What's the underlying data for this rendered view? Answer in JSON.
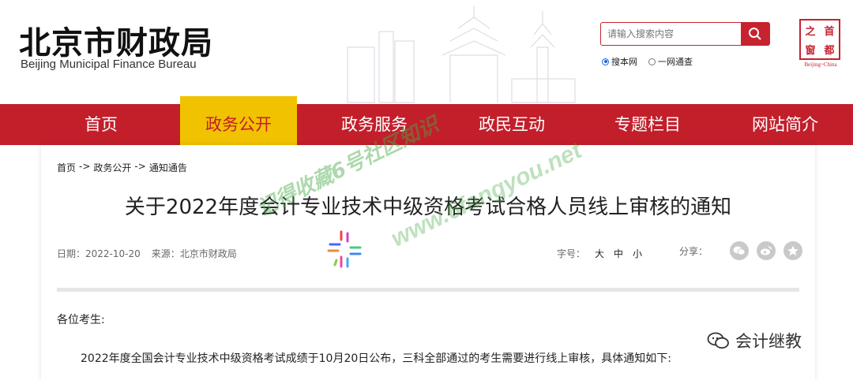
{
  "header": {
    "title_cn": "北京市财政局",
    "title_en": "Beijing Municipal Finance Bureau",
    "search": {
      "placeholder": "请输入搜索内容"
    },
    "scope_options": [
      {
        "label": "搜本网",
        "selected": true
      },
      {
        "label": "一网通查",
        "selected": false
      }
    ],
    "seal": {
      "chars": [
        "之",
        "首",
        "窗",
        "都"
      ],
      "caption": "Beijing~China"
    }
  },
  "nav": {
    "items": [
      {
        "label": "首页",
        "active": false
      },
      {
        "label": "政务公开",
        "active": true
      },
      {
        "label": "政务服务",
        "active": false
      },
      {
        "label": "政民互动",
        "active": false
      },
      {
        "label": "专题栏目",
        "active": false
      },
      {
        "label": "网站简介",
        "active": false
      }
    ]
  },
  "breadcrumb": {
    "items": [
      "首页",
      "政务公开",
      "通知通告"
    ],
    "separator": "->"
  },
  "article": {
    "title": "关于2022年度会计专业技术中级资格考试合格人员线上审核的通知",
    "date_label": "日期：",
    "date": "2022-10-20",
    "source_label": "来源：",
    "source": "北京市财政局",
    "font_size_label": "字号：",
    "font_sizes": [
      "大",
      "中",
      "小"
    ],
    "share_label": "分享：",
    "share_icons": [
      "wechat-icon",
      "weibo-icon",
      "favorite-icon"
    ],
    "greeting": "各位考生:",
    "paragraph": "2022年度全国会计专业技术中级资格考试成绩于10月20日公布，三科全部通过的考生需要进行线上审核，具体通知如下:"
  },
  "watermarks": {
    "line1": "记得收藏6号社区知识",
    "line2": "www.6fangyou.net",
    "wechat_account": "会计继教"
  },
  "colors": {
    "brand_red": "#c21f2b",
    "active_yellow": "#f1c200",
    "radio_blue": "#1a63d6"
  }
}
